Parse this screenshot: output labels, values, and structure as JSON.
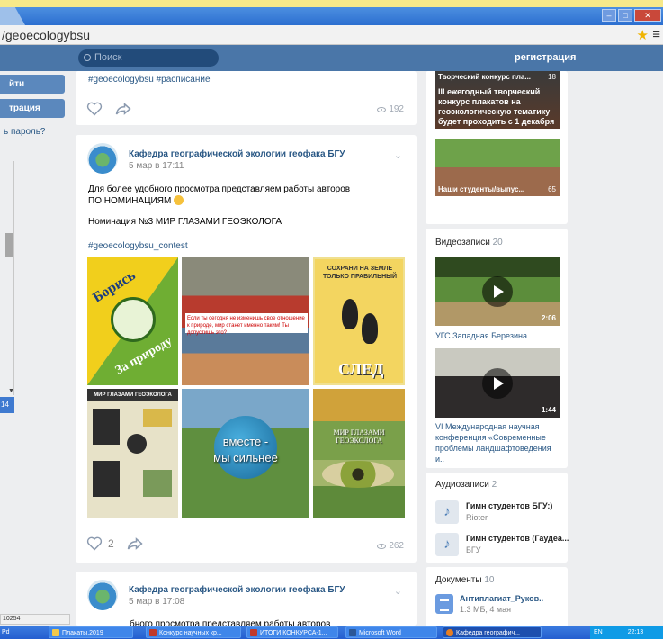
{
  "browser": {
    "url": "/geoecologybsu",
    "window_buttons": [
      "‒",
      "□",
      "✕"
    ]
  },
  "header": {
    "search_placeholder": "Поиск",
    "register_label": "регистрация"
  },
  "left_panel": {
    "login_label": "йти",
    "register_label": "трация",
    "forgot_label": "ь пароль?",
    "counter": "14"
  },
  "posts": [
    {
      "tags": "#geoecologybsu #расписание",
      "views": "192"
    },
    {
      "author": "Кафедра географической экологии геофака БГУ",
      "date": "5 мар в 17:11",
      "text_line1": "Для более удобного просмотра представляем работы авторов",
      "text_line2": "ПО НОМИНАЦИЯМ",
      "text_line3": "Номинация №3 МИР ГЛАЗАМИ ГЕОЭКОЛОГА",
      "tags": "#geoecologybsu_contest",
      "likes": "2",
      "views": "262",
      "images": {
        "tile1_top": "Борись",
        "tile1_bottom": "За природу",
        "tile2_text": "Если ты сегодня не изменишь свое отношение к природе, мир станет именно таким! Ты допустишь это?",
        "tile3_caption": "СОХРАНИ НА ЗЕМЛЕ ТОЛЬКО ПРАВИЛЬНЫЙ",
        "tile3_word": "СЛЕД",
        "tile4_header": "МИР ГЛАЗАМИ ГЕОЭКОЛОГА",
        "tile5_line1": "вместе -",
        "tile5_line2": "мы сильнее",
        "tile6_caption": "МИР ГЛАЗАМИ ГЕОЭКОЛОГА"
      }
    },
    {
      "author": "Кафедра географической экологии геофака БГУ",
      "date": "5 мар в 17:08",
      "text_partial": "бного просмотра представляем работы авторов"
    }
  ],
  "right_panel": {
    "photos": [
      {
        "caption": "Творческий конкурс пла...",
        "count": "18",
        "overlay": "III ежегодный творческий конкурс плакатов на геоэкологическую тематику будет проходить с 1 декабря"
      },
      {
        "caption": "Наши студенты/выпус...",
        "count": "65"
      }
    ],
    "videos_title": "Видеозаписи",
    "videos_count": "20",
    "videos": [
      {
        "duration": "2:06",
        "title": "УГС Западная Березина"
      },
      {
        "duration": "1:44",
        "title": "VI Международная научная конференция «Современные проблемы ландшафтоведения и.."
      }
    ],
    "audio_title": "Аудиозаписи",
    "audio_count": "2",
    "audio": [
      {
        "name": "Гимн студентов БГУ:)",
        "artist": "Rioter"
      },
      {
        "name": "Гимн студентов (Гаудеа...",
        "artist": "БГУ"
      }
    ],
    "docs_title": "Документы",
    "docs_count": "10",
    "docs": [
      {
        "name": "Антиплагиат_Руков..",
        "meta": "1.3 МБ, 4 мая"
      }
    ]
  },
  "statusbar": {
    "text": "10254"
  },
  "taskbar": {
    "start": "Pd",
    "items": [
      {
        "label": "Плакаты.2019",
        "color": "#f2c94c"
      },
      {
        "label": "Конкурс научных кр...",
        "color": "#c0392b"
      },
      {
        "label": "ИТОГИ КОНКУРСА-1...",
        "color": "#c0392b"
      },
      {
        "label": "Microsoft Word",
        "color": "#2b5797"
      },
      {
        "label": "Кафедра географич...",
        "color": "#e67e22"
      }
    ],
    "tray_lang": "EN",
    "tray_time": "22:13"
  },
  "colors": {
    "vk_header": "#4a76a8",
    "link": "#2a5885",
    "page_bg": "#edeef0"
  }
}
